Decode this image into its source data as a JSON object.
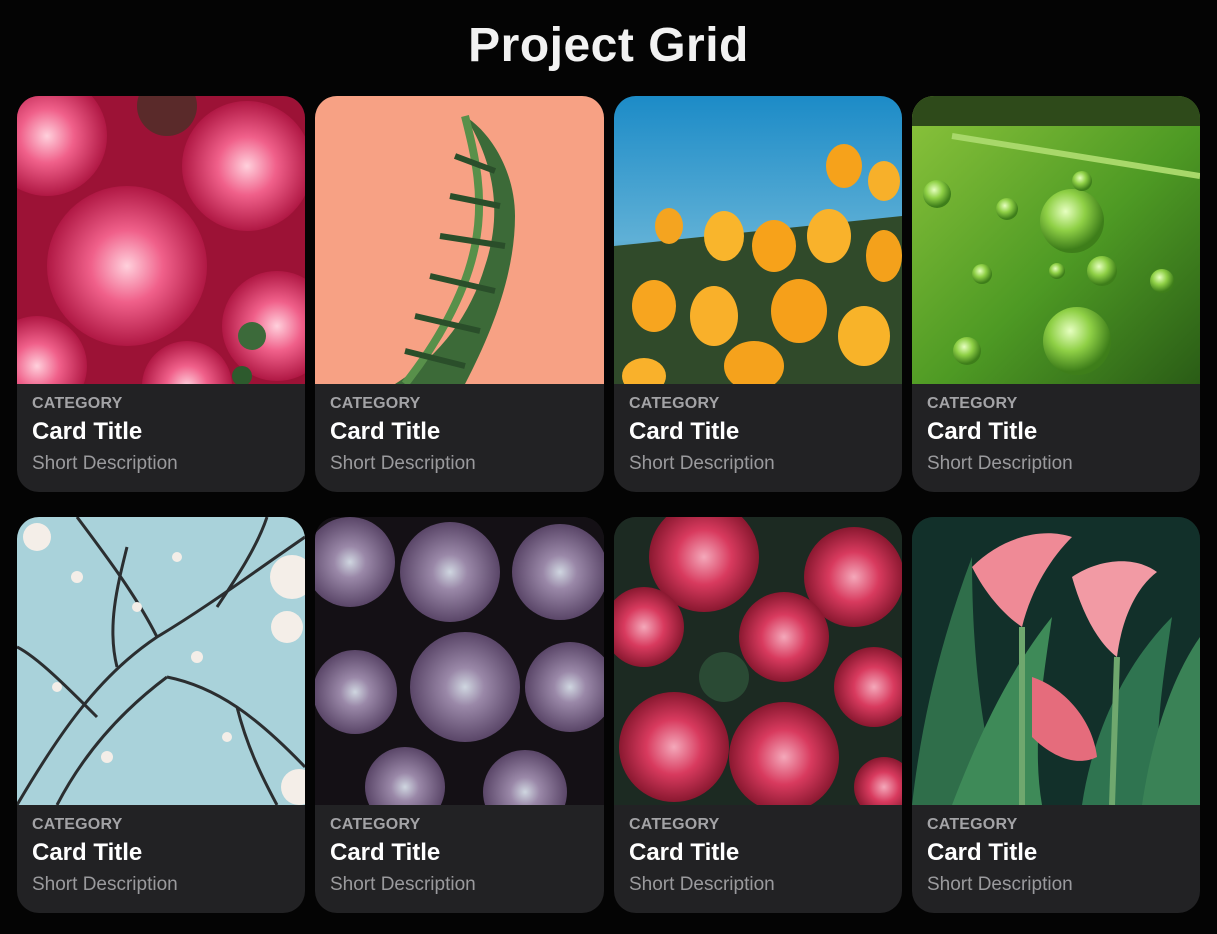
{
  "page": {
    "title": "Project Grid"
  },
  "cards": [
    {
      "category": "CATEGORY",
      "title": "Card Title",
      "description": "Short Description",
      "image": "pink-dahlias"
    },
    {
      "category": "CATEGORY",
      "title": "Card Title",
      "description": "Short Description",
      "image": "fern-on-peach"
    },
    {
      "category": "CATEGORY",
      "title": "Card Title",
      "description": "Short Description",
      "image": "orange-poppies"
    },
    {
      "category": "CATEGORY",
      "title": "Card Title",
      "description": "Short Description",
      "image": "leaf-water-drops"
    },
    {
      "category": "CATEGORY",
      "title": "Card Title",
      "description": "Short Description",
      "image": "blossom-branches"
    },
    {
      "category": "CATEGORY",
      "title": "Card Title",
      "description": "Short Description",
      "image": "purple-succulents"
    },
    {
      "category": "CATEGORY",
      "title": "Card Title",
      "description": "Short Description",
      "image": "red-hydrangeas"
    },
    {
      "category": "CATEGORY",
      "title": "Card Title",
      "description": "Short Description",
      "image": "calla-lilies"
    }
  ],
  "colors": {
    "background": "#040404",
    "card_background": "#222224",
    "title_text": "#ffffff",
    "category_text": "#a3a3a6",
    "description_text": "#9a9a9d"
  }
}
